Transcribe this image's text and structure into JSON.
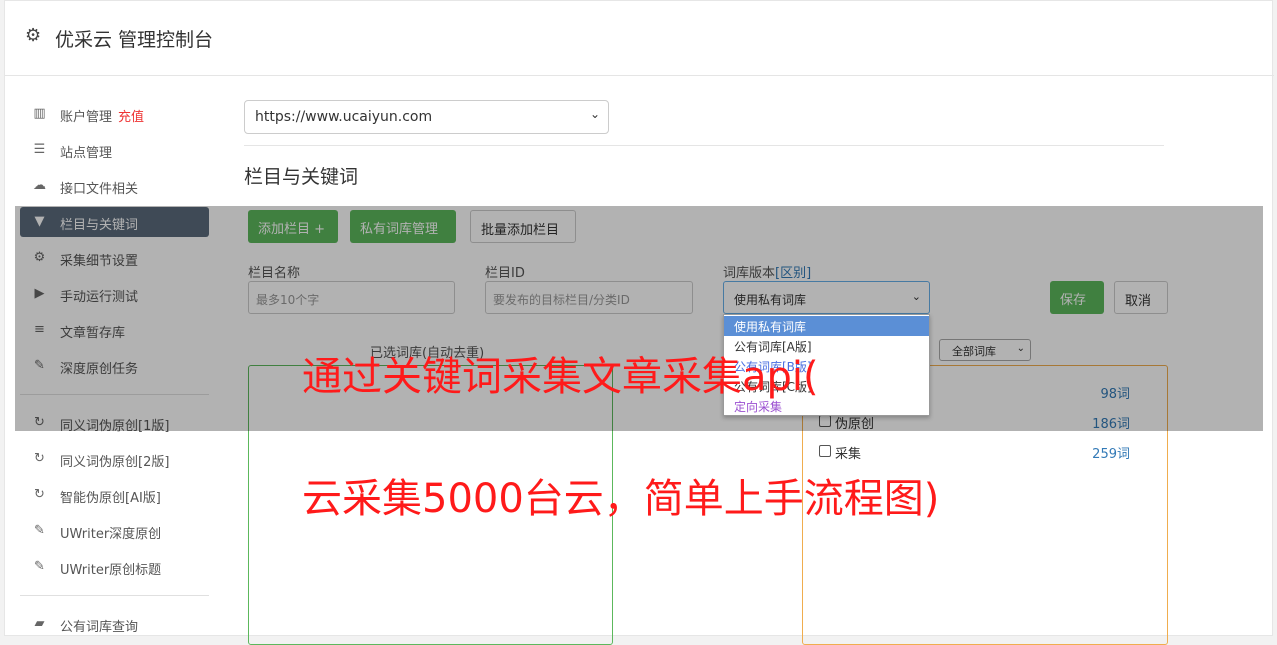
{
  "header": {
    "title": "优采云 管理控制台",
    "icon": "gear-icon"
  },
  "sidebar": {
    "items": [
      {
        "label": "账户管理",
        "tag": "充值",
        "icon": "bar-chart-icon"
      },
      {
        "label": "站点管理",
        "icon": "server-icon"
      },
      {
        "label": "接口文件相关",
        "icon": "cloud-upload-icon"
      },
      {
        "label": "栏目与关键词",
        "icon": "filter-icon",
        "active": true
      },
      {
        "label": "采集细节设置",
        "icon": "cogs-icon"
      },
      {
        "label": "手动运行测试",
        "icon": "play-icon"
      },
      {
        "label": "文章暂存库",
        "icon": "database-icon"
      },
      {
        "label": "深度原创任务",
        "icon": "edit-icon"
      },
      {
        "label": "同义词伪原创[1版]",
        "icon": "refresh-icon"
      },
      {
        "label": "同义词伪原创[2版]",
        "icon": "refresh-icon"
      },
      {
        "label": "智能伪原创[AI版]",
        "icon": "refresh-icon"
      },
      {
        "label": "UWriter深度原创",
        "icon": "edit-icon"
      },
      {
        "label": "UWriter原创标题",
        "icon": "edit-icon"
      },
      {
        "label": "公有词库查询",
        "icon": "book-icon"
      }
    ]
  },
  "main": {
    "site_select": "https://www.ucaiyun.com",
    "section_title": "栏目与关键词",
    "buttons": {
      "add_column": "添加栏目 +",
      "private_lib": "私有词库管理",
      "batch_add": "批量添加栏目"
    },
    "form": {
      "name_label": "栏目名称",
      "name_placeholder": "最多10个字",
      "id_label": "栏目ID",
      "id_placeholder": "要发布的目标栏目/分类ID",
      "version_label": "词库版本",
      "version_link": "[区别]",
      "version_value": "使用私有词库",
      "save": "保存",
      "cancel": "取消"
    },
    "selected_lib_label": "已选词库(自动去重)",
    "all_libs_select": "全部词库",
    "libraries": [
      {
        "name": "",
        "count": "98词"
      },
      {
        "name": "伪原创",
        "count": "186词"
      },
      {
        "name": "采集",
        "count": "259词"
      }
    ],
    "dropdown_options": [
      "使用私有词库",
      "公有词库[A版]",
      "公有词库[B版]",
      "公有词库[C版]",
      "定向采集"
    ]
  },
  "overlay_text": {
    "line1": "通过关键词采集文章采集api(",
    "line2": "云采集5000台云，简单上手流程图)"
  }
}
